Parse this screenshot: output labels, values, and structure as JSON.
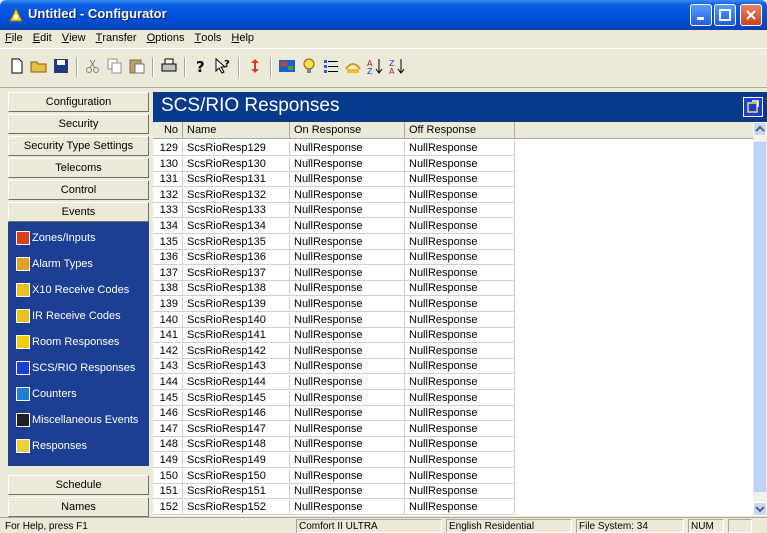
{
  "window": {
    "title": "Untitled - Configurator"
  },
  "menu": [
    {
      "label": "File",
      "u": "F",
      "rest": "ile"
    },
    {
      "label": "Edit",
      "u": "E",
      "rest": "dit"
    },
    {
      "label": "View",
      "u": "V",
      "rest": "iew"
    },
    {
      "label": "Transfer",
      "u": "T",
      "rest": "ransfer"
    },
    {
      "label": "Options",
      "u": "O",
      "rest": "ptions"
    },
    {
      "label": "Tools",
      "u": "T",
      "rest": "ools"
    },
    {
      "label": "Help",
      "u": "H",
      "rest": "elp"
    }
  ],
  "nav_buttons": {
    "configuration": "Configuration",
    "security": "Security",
    "security_type": "Security Type Settings",
    "telecoms": "Telecoms",
    "control": "Control",
    "events": "Events",
    "schedule": "Schedule",
    "names": "Names"
  },
  "nav_items": [
    {
      "label": "Zones/Inputs",
      "icon": "zones-icon",
      "color": "#d84020"
    },
    {
      "label": "Alarm Types",
      "icon": "alarm-types-icon",
      "color": "#e0a020"
    },
    {
      "label": "X10 Receive Codes",
      "icon": "x10-icon",
      "color": "#e8c020"
    },
    {
      "label": "IR Receive Codes",
      "icon": "ir-icon",
      "color": "#e8c020"
    },
    {
      "label": "Room Responses",
      "icon": "room-icon",
      "color": "#f0d000"
    },
    {
      "label": "SCS/RIO Responses",
      "icon": "scs-rio-icon",
      "color": "#1c3fd8"
    },
    {
      "label": "Counters",
      "icon": "counters-icon",
      "color": "#2080d0"
    },
    {
      "label": "Miscellaneous Events",
      "icon": "misc-events-icon",
      "color": "#202020"
    },
    {
      "label": "Responses",
      "icon": "responses-icon",
      "color": "#e8d040"
    }
  ],
  "main": {
    "title": "SCS/RIO Responses"
  },
  "table": {
    "columns": [
      "No",
      "Name",
      "On Response",
      "Off Response"
    ],
    "rows": [
      [
        "129",
        "ScsRioResp129",
        "NullResponse",
        "NullResponse"
      ],
      [
        "130",
        "ScsRioResp130",
        "NullResponse",
        "NullResponse"
      ],
      [
        "131",
        "ScsRioResp131",
        "NullResponse",
        "NullResponse"
      ],
      [
        "132",
        "ScsRioResp132",
        "NullResponse",
        "NullResponse"
      ],
      [
        "133",
        "ScsRioResp133",
        "NullResponse",
        "NullResponse"
      ],
      [
        "134",
        "ScsRioResp134",
        "NullResponse",
        "NullResponse"
      ],
      [
        "135",
        "ScsRioResp135",
        "NullResponse",
        "NullResponse"
      ],
      [
        "136",
        "ScsRioResp136",
        "NullResponse",
        "NullResponse"
      ],
      [
        "137",
        "ScsRioResp137",
        "NullResponse",
        "NullResponse"
      ],
      [
        "138",
        "ScsRioResp138",
        "NullResponse",
        "NullResponse"
      ],
      [
        "139",
        "ScsRioResp139",
        "NullResponse",
        "NullResponse"
      ],
      [
        "140",
        "ScsRioResp140",
        "NullResponse",
        "NullResponse"
      ],
      [
        "141",
        "ScsRioResp141",
        "NullResponse",
        "NullResponse"
      ],
      [
        "142",
        "ScsRioResp142",
        "NullResponse",
        "NullResponse"
      ],
      [
        "143",
        "ScsRioResp143",
        "NullResponse",
        "NullResponse"
      ],
      [
        "144",
        "ScsRioResp144",
        "NullResponse",
        "NullResponse"
      ],
      [
        "145",
        "ScsRioResp145",
        "NullResponse",
        "NullResponse"
      ],
      [
        "146",
        "ScsRioResp146",
        "NullResponse",
        "NullResponse"
      ],
      [
        "147",
        "ScsRioResp147",
        "NullResponse",
        "NullResponse"
      ],
      [
        "148",
        "ScsRioResp148",
        "NullResponse",
        "NullResponse"
      ],
      [
        "149",
        "ScsRioResp149",
        "NullResponse",
        "NullResponse"
      ],
      [
        "150",
        "ScsRioResp150",
        "NullResponse",
        "NullResponse"
      ],
      [
        "151",
        "ScsRioResp151",
        "NullResponse",
        "NullResponse"
      ],
      [
        "152",
        "ScsRioResp152",
        "NullResponse",
        "NullResponse"
      ]
    ]
  },
  "status": {
    "help": "For Help, press F1",
    "product": "Comfort II ULTRA",
    "locale": "English Residential",
    "filesystem": "File System: 34",
    "num": "NUM"
  },
  "colors": {
    "titlebar": "#0052dc",
    "nav_bg": "#1c3f94",
    "header_bg": "#083a8c"
  }
}
